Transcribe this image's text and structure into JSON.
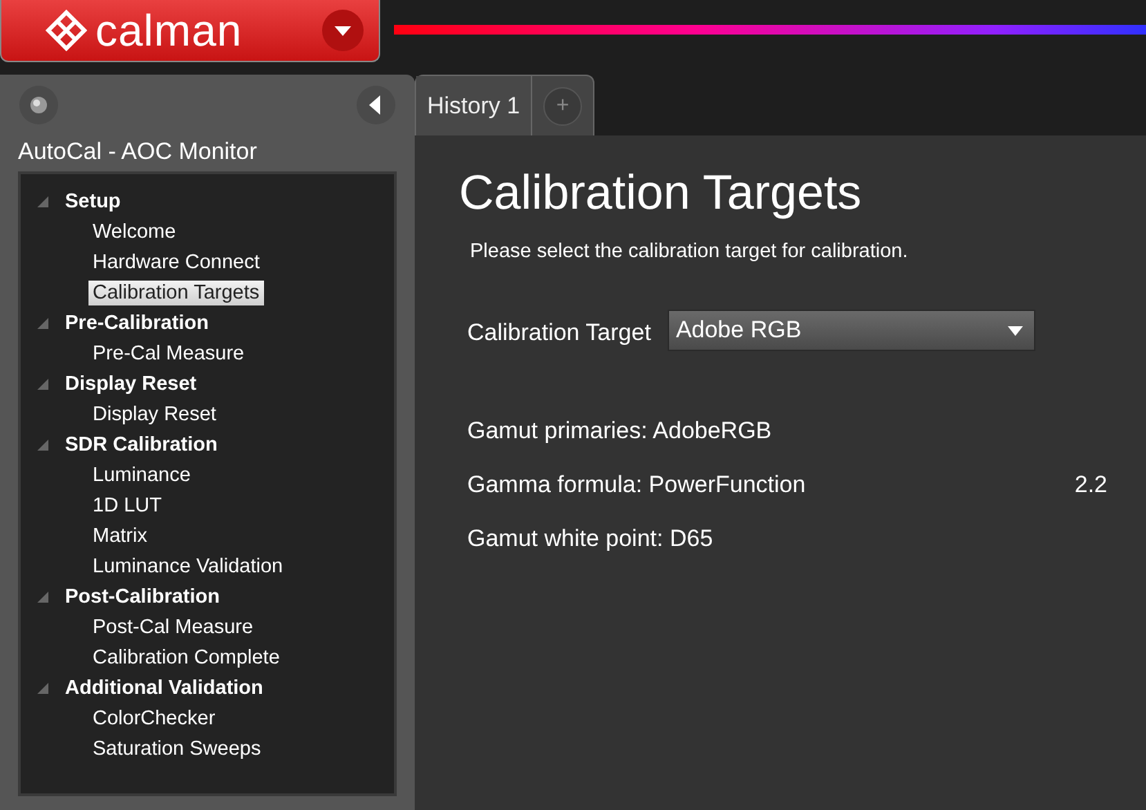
{
  "app": {
    "logo": "calman"
  },
  "sidebar": {
    "title": "AutoCal - AOC Monitor",
    "tree": [
      {
        "label": "Setup",
        "expanded": true,
        "children": [
          {
            "label": "Welcome",
            "selected": false
          },
          {
            "label": "Hardware Connect",
            "selected": false
          },
          {
            "label": "Calibration Targets",
            "selected": true
          }
        ]
      },
      {
        "label": "Pre-Calibration",
        "expanded": true,
        "children": [
          {
            "label": "Pre-Cal Measure",
            "selected": false
          }
        ]
      },
      {
        "label": "Display Reset",
        "expanded": true,
        "children": [
          {
            "label": "Display Reset",
            "selected": false
          }
        ]
      },
      {
        "label": "SDR Calibration",
        "expanded": true,
        "children": [
          {
            "label": "Luminance",
            "selected": false
          },
          {
            "label": "1D LUT",
            "selected": false
          },
          {
            "label": "Matrix",
            "selected": false
          },
          {
            "label": "Luminance Validation",
            "selected": false
          }
        ]
      },
      {
        "label": "Post-Calibration",
        "expanded": true,
        "children": [
          {
            "label": "Post-Cal Measure",
            "selected": false
          },
          {
            "label": "Calibration Complete",
            "selected": false
          }
        ]
      },
      {
        "label": "Additional Validation",
        "expanded": true,
        "children": [
          {
            "label": "ColorChecker",
            "selected": false
          },
          {
            "label": "Saturation Sweeps",
            "selected": false
          }
        ]
      }
    ]
  },
  "tabs": [
    {
      "label": "History 1",
      "selected": true
    },
    {
      "label": "+",
      "kind": "add"
    }
  ],
  "content": {
    "title": "Calibration Targets",
    "instruction": "Please select the calibration target for calibration.",
    "target_label": "Calibration Target",
    "target_value": "Adobe RGB",
    "properties": [
      {
        "label": "Gamut primaries: AdobeRGB"
      },
      {
        "label": "Gamma formula: PowerFunction",
        "value": "2.2"
      },
      {
        "label": "Gamut white point: D65"
      }
    ]
  }
}
